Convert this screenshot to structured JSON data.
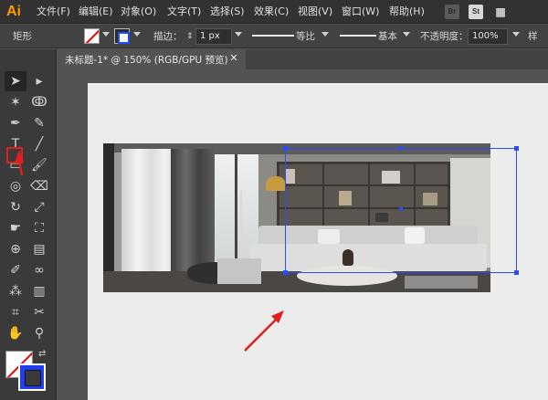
{
  "app": {
    "logo": "Ai"
  },
  "menu": [
    {
      "label": "文件(F)"
    },
    {
      "label": "编辑(E)"
    },
    {
      "label": "对象(O)"
    },
    {
      "label": "文字(T)"
    },
    {
      "label": "选择(S)"
    },
    {
      "label": "效果(C)"
    },
    {
      "label": "视图(V)"
    },
    {
      "label": "窗口(W)"
    },
    {
      "label": "帮助(H)"
    }
  ],
  "app_switcher": {
    "bridge": "Br",
    "stock": "St",
    "grid": "▦"
  },
  "control": {
    "shape_name": "矩形",
    "stroke_label": "描边：",
    "stroke_width": "1 px",
    "profile_label": "等比",
    "brush_label": "基本",
    "opacity_label": "不透明度：",
    "opacity_value": "100%",
    "style_label": "样"
  },
  "document": {
    "tab_title": "未标题-1* @ 150% (RGB/GPU 预览)",
    "close_glyph": "✕"
  },
  "tools": [
    {
      "name": "selection-tool-icon",
      "glyph": "➤"
    },
    {
      "name": "direct-selection-tool-icon",
      "glyph": "▸"
    },
    {
      "name": "magic-wand-tool-icon",
      "glyph": "✶"
    },
    {
      "name": "lasso-tool-icon",
      "glyph": "ↂ"
    },
    {
      "name": "pen-tool-icon",
      "glyph": "✒"
    },
    {
      "name": "curvature-tool-icon",
      "glyph": "✎"
    },
    {
      "name": "type-tool-icon",
      "glyph": "T"
    },
    {
      "name": "line-tool-icon",
      "glyph": "╱"
    },
    {
      "name": "rectangle-tool-icon",
      "glyph": "▭"
    },
    {
      "name": "paintbrush-tool-icon",
      "glyph": "🖌"
    },
    {
      "name": "shaper-tool-icon",
      "glyph": "◎"
    },
    {
      "name": "eraser-tool-icon",
      "glyph": "⌫"
    },
    {
      "name": "rotate-tool-icon",
      "glyph": "↻"
    },
    {
      "name": "scale-tool-icon",
      "glyph": "⤢"
    },
    {
      "name": "warp-tool-icon",
      "glyph": "☛"
    },
    {
      "name": "free-transform-tool-icon",
      "glyph": "⛶"
    },
    {
      "name": "shape-builder-tool-icon",
      "glyph": "⊕"
    },
    {
      "name": "gradient-tool-icon",
      "glyph": "▤"
    },
    {
      "name": "eyedropper-tool-icon",
      "glyph": "✐"
    },
    {
      "name": "blend-tool-icon",
      "glyph": "∞"
    },
    {
      "name": "symbol-sprayer-tool-icon",
      "glyph": "⁂"
    },
    {
      "name": "column-graph-tool-icon",
      "glyph": "▥"
    },
    {
      "name": "artboard-tool-icon",
      "glyph": "⌗"
    },
    {
      "name": "slice-tool-icon",
      "glyph": "✂"
    },
    {
      "name": "hand-tool-icon",
      "glyph": "✋"
    },
    {
      "name": "zoom-tool-icon",
      "glyph": "⚲"
    }
  ],
  "colors": {
    "accent_red": "#e21f1f",
    "selection_blue": "#2c4cff",
    "ai_orange": "#ff9a00"
  }
}
